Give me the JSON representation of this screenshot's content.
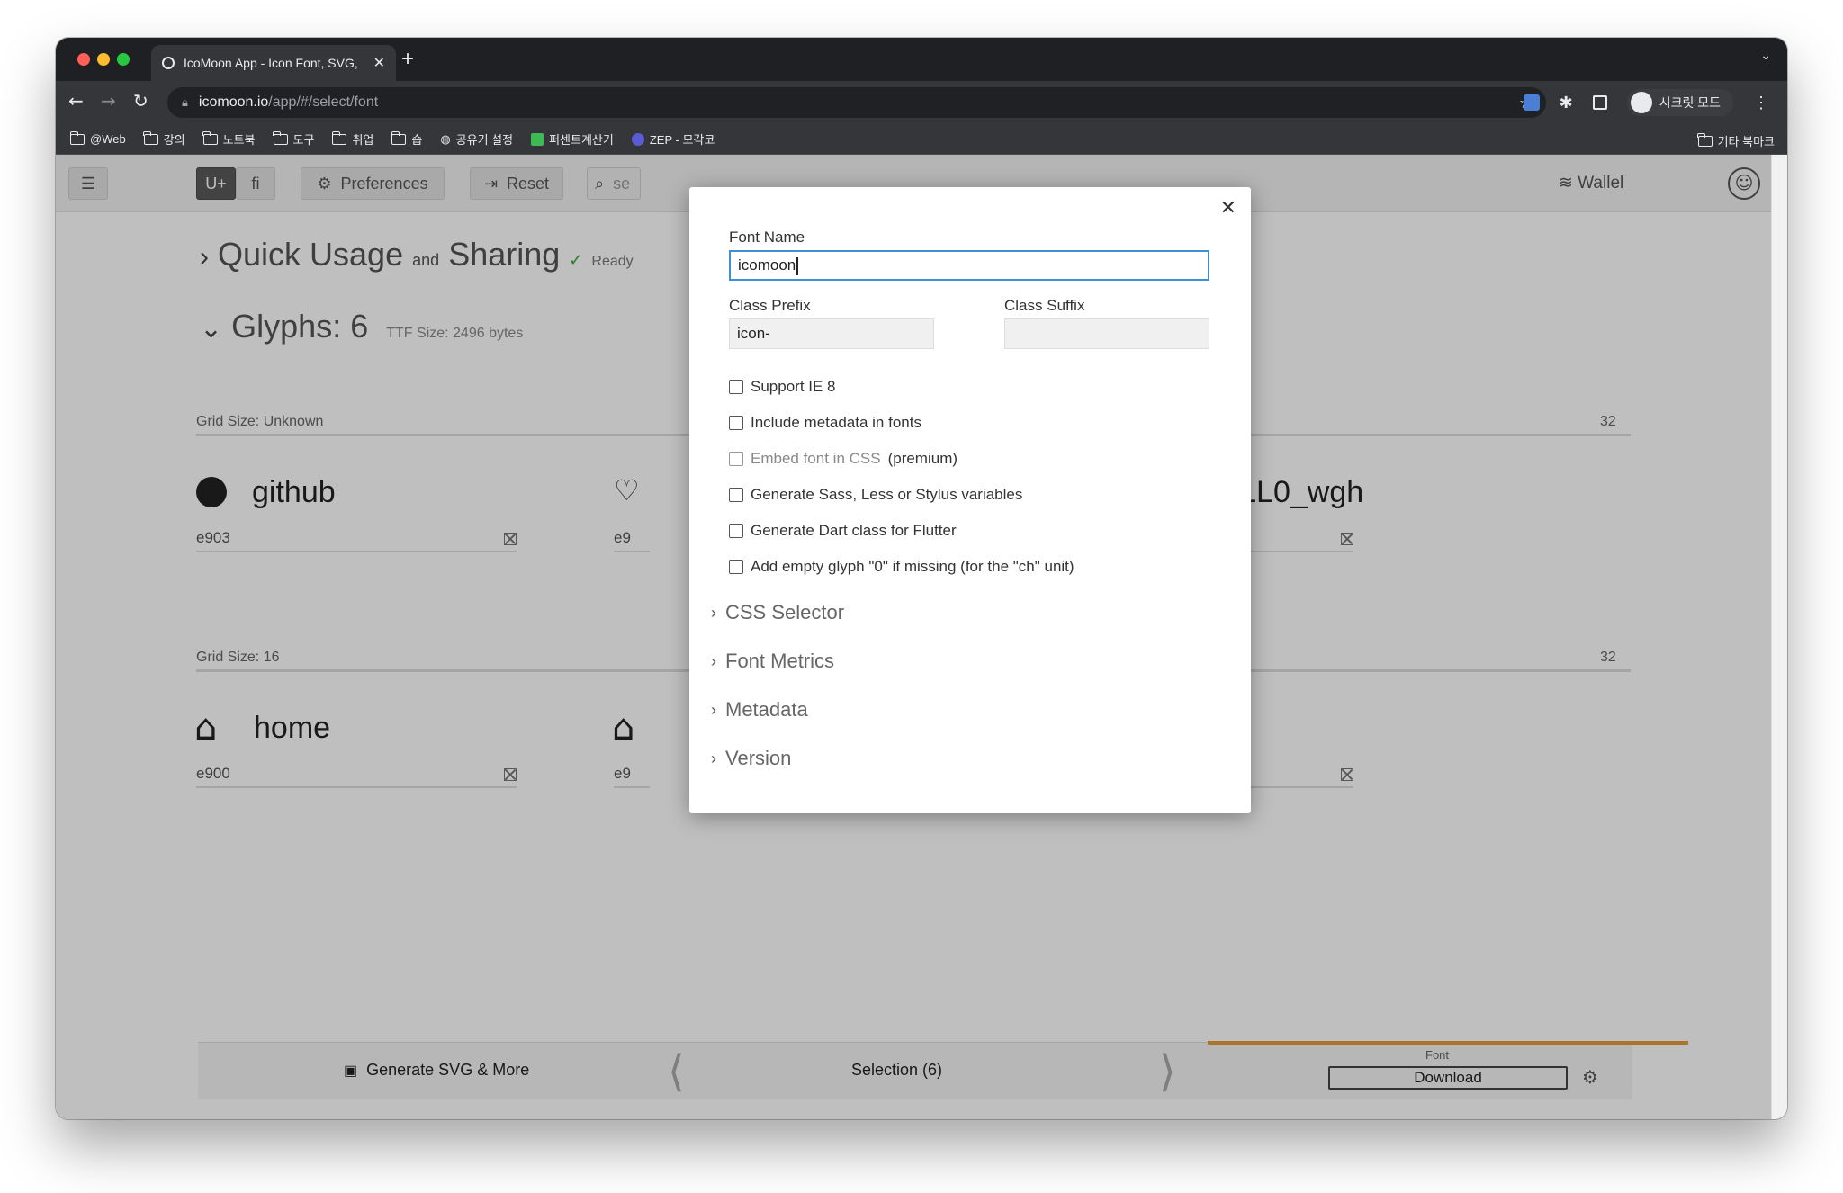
{
  "browser": {
    "tab_title": "IcoMoon App - Icon Font, SVG,",
    "url_host": "icomoon.io",
    "url_path": "/app/#/select/font",
    "incognito_label": "시크릿 모드",
    "bookmarks": [
      "@Web",
      "강의",
      "노트북",
      "도구",
      "취업",
      "숍",
      "공유기 설정",
      "퍼센트계산기",
      "ZEP - 모각코"
    ],
    "other_bookmarks": "기타 북마크"
  },
  "app": {
    "toolbar": {
      "unicode_label": "U+",
      "ligature_label": "ﬁ",
      "preferences_label": "Preferences",
      "reset_label": "Reset",
      "search_placeholder": "se",
      "wallet_label": "Wallel"
    },
    "quick_usage": {
      "part1": "Quick Usage",
      "and": "and",
      "part2": "Sharing",
      "ready": "Ready"
    },
    "glyphs_heading": "Glyphs: 6",
    "ttf_size": "TTF Size: 2496 bytes",
    "grids": [
      {
        "label": "Grid Size: Unknown",
        "count": "32",
        "glyphs": [
          {
            "name": "github",
            "code": "e903"
          },
          {
            "name": "",
            "code": "e9"
          },
          {
            "name": "_FILL0_wgh",
            "code": ""
          }
        ]
      },
      {
        "label": "Grid Size: 16",
        "count": "32",
        "glyphs": [
          {
            "name": "home",
            "code": "e900"
          },
          {
            "name": "",
            "code": "e9"
          },
          {
            "name": "",
            "code": ""
          }
        ]
      }
    ],
    "footer": {
      "generate_label": "Generate SVG & More",
      "selection_label": "Selection (6)",
      "font_label": "Font",
      "download_label": "Download"
    }
  },
  "modal": {
    "font_name_label": "Font Name",
    "font_name_value": "icomoon",
    "class_prefix_label": "Class Prefix",
    "class_prefix_value": "icon-",
    "class_suffix_label": "Class Suffix",
    "class_suffix_value": "",
    "options": [
      "Support IE 8",
      "Include metadata in fonts",
      "Embed font in CSS",
      "Generate Sass, Less or Stylus variables",
      "Generate Dart class for Flutter",
      "Add empty glyph \"0\" if missing (for the \"ch\" unit)"
    ],
    "premium_label": "(premium)",
    "sections": [
      "CSS Selector",
      "Font Metrics",
      "Metadata",
      "Version"
    ]
  }
}
